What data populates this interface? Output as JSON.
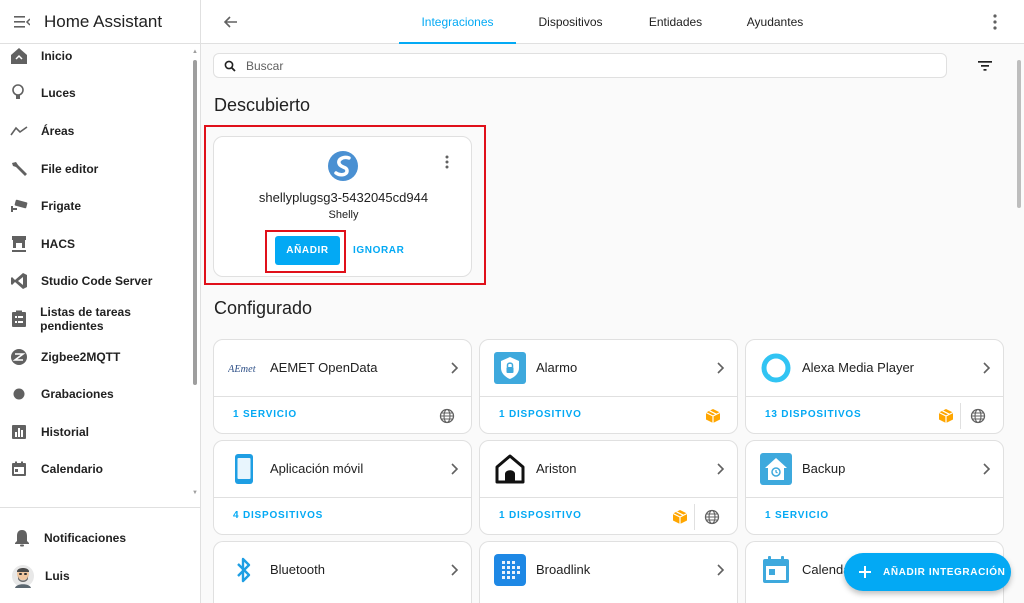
{
  "app": {
    "title": "Home Assistant"
  },
  "sidebar": {
    "items": [
      {
        "label": "Inicio",
        "icon": "home-icon"
      },
      {
        "label": "Luces",
        "icon": "lightbulb-icon"
      },
      {
        "label": "Áreas",
        "icon": "areas-icon"
      },
      {
        "label": "File editor",
        "icon": "wrench-icon"
      },
      {
        "label": "Frigate",
        "icon": "cctv-icon"
      },
      {
        "label": "HACS",
        "icon": "hacs-icon"
      },
      {
        "label": "Studio Code Server",
        "icon": "vscode-icon"
      },
      {
        "label": "Listas de tareas pendientes",
        "icon": "clipboard-list-icon"
      },
      {
        "label": "Zigbee2MQTT",
        "icon": "zigbee-icon"
      },
      {
        "label": "Grabaciones",
        "icon": "record-icon"
      },
      {
        "label": "Historial",
        "icon": "chart-box-icon"
      },
      {
        "label": "Calendario",
        "icon": "calendar-icon"
      }
    ],
    "notifications_label": "Notificaciones",
    "user_name": "Luis"
  },
  "tabs": [
    "Integraciones",
    "Dispositivos",
    "Entidades",
    "Ayudantes"
  ],
  "search": {
    "placeholder": "Buscar"
  },
  "discovered": {
    "title": "Descubierto",
    "card": {
      "name": "shellyplugsg3-5432045cd944",
      "brand": "Shelly",
      "add_label": "AÑADIR",
      "ignore_label": "IGNORAR"
    }
  },
  "configured": {
    "title": "Configurado",
    "cards": [
      {
        "name": "AEMET OpenData",
        "logo": "aemet-logo",
        "link": "1 SERVICIO",
        "badges": [
          "globe-icon"
        ]
      },
      {
        "name": "Alarmo",
        "logo": "alarmo-shield-icon",
        "link": "1 DISPOSITIVO",
        "badges": [
          "package-icon"
        ]
      },
      {
        "name": "Alexa Media Player",
        "logo": "alexa-ring-icon",
        "link": "13 DISPOSITIVOS",
        "badges": [
          "package-icon",
          "globe-icon"
        ]
      },
      {
        "name": "Aplicación móvil",
        "logo": "cellphone-icon",
        "link": "4 DISPOSITIVOS",
        "badges": []
      },
      {
        "name": "Ariston",
        "logo": "ariston-house-icon",
        "link": "1 DISPOSITIVO",
        "badges": [
          "package-icon",
          "globe-icon"
        ]
      },
      {
        "name": "Backup",
        "logo": "backup-house-icon",
        "link": "1 SERVICIO",
        "badges": []
      },
      {
        "name": "Bluetooth",
        "logo": "bluetooth-icon",
        "link": "",
        "badges": []
      },
      {
        "name": "Broadlink",
        "logo": "broadlink-icon",
        "link": "",
        "badges": []
      },
      {
        "name": "Calendar",
        "logo": "calendar-logo-icon",
        "link": "",
        "badges": []
      }
    ]
  },
  "fab": {
    "label": "AÑADIR INTEGRACIÓN"
  },
  "colors": {
    "primary": "#03a9f4",
    "highlight": "#e0101a",
    "package": "#ffa600"
  }
}
